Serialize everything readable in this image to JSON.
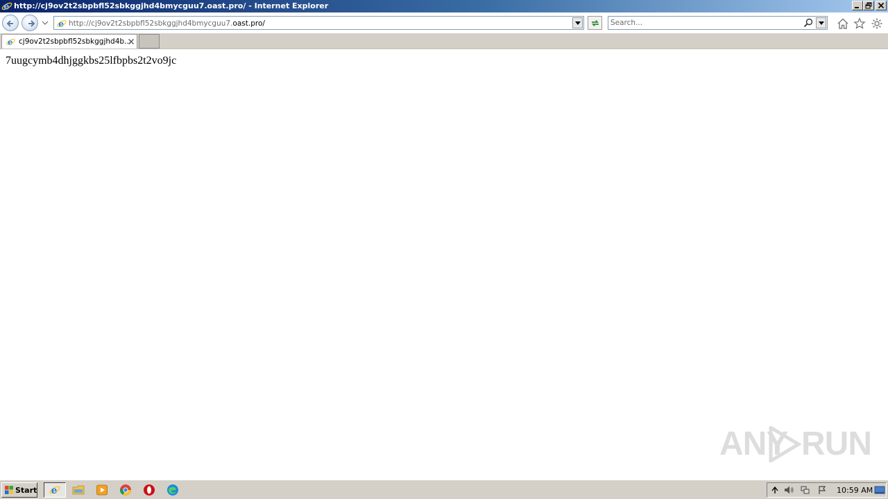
{
  "window": {
    "title": "http://cj9ov2t2sbpbfl52sbkggjhd4bmycguu7.oast.pro/ - Internet Explorer",
    "minimize_label": "minimize",
    "restore_label": "restore",
    "close_label": "close"
  },
  "address_bar": {
    "url_prefix": "http://cj9ov2t2sbpbfl52sbkggjhd4bmycguu7.",
    "url_host_strong": "oast.pro/"
  },
  "search": {
    "placeholder": "Search..."
  },
  "tabs": [
    {
      "label": "cj9ov2t2sbpbfl52sbkggjhd4b...",
      "active": true
    }
  ],
  "page": {
    "body_text": "7uugcymb4dhjggkbs25lfbpbs2t2vo9jc"
  },
  "watermark": {
    "left_text": "ANY",
    "right_text": "RUN"
  },
  "taskbar": {
    "start_label": "Start",
    "clock": "10:59 AM",
    "pinned": [
      "internet-explorer",
      "file-explorer",
      "media-player",
      "chrome",
      "opera",
      "edge"
    ]
  },
  "colors": {
    "titlebar_start": "#0a246a",
    "titlebar_end": "#a6caf0",
    "chrome_gray": "#d4d0c8",
    "ie_blue": "#1e7fd6"
  }
}
